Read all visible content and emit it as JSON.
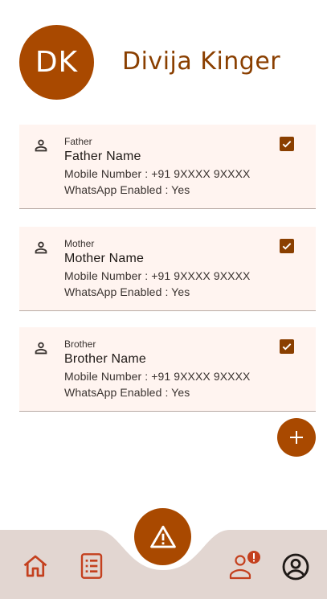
{
  "profile": {
    "initials": "DK",
    "name": "Divija Kinger"
  },
  "contacts": [
    {
      "relation": "Father",
      "name": "Father Name",
      "mobile": "Mobile Number : +91 9XXXX 9XXXX",
      "whatsapp": "WhatsApp Enabled : Yes",
      "checked": true
    },
    {
      "relation": "Mother",
      "name": "Mother Name",
      "mobile": "Mobile Number : +91 9XXXX 9XXXX",
      "whatsapp": "WhatsApp Enabled : Yes",
      "checked": true
    },
    {
      "relation": "Brother",
      "name": "Brother Name",
      "mobile": "Mobile Number : +91 9XXXX 9XXXX",
      "whatsapp": "WhatsApp Enabled : Yes",
      "checked": true
    }
  ],
  "fab": {
    "icon": "plus-icon"
  },
  "bottom_nav": {
    "items": [
      {
        "icon": "home-icon"
      },
      {
        "icon": "document-list-icon"
      },
      {
        "icon": "warning-icon"
      },
      {
        "icon": "person-alert-icon"
      },
      {
        "icon": "account-circle-icon"
      }
    ],
    "badge": "!"
  },
  "colors": {
    "accent": "#a94900",
    "accent_dark": "#8a3f00",
    "card_bg": "#fff4f0",
    "nav_bg": "#e2d6d1"
  }
}
